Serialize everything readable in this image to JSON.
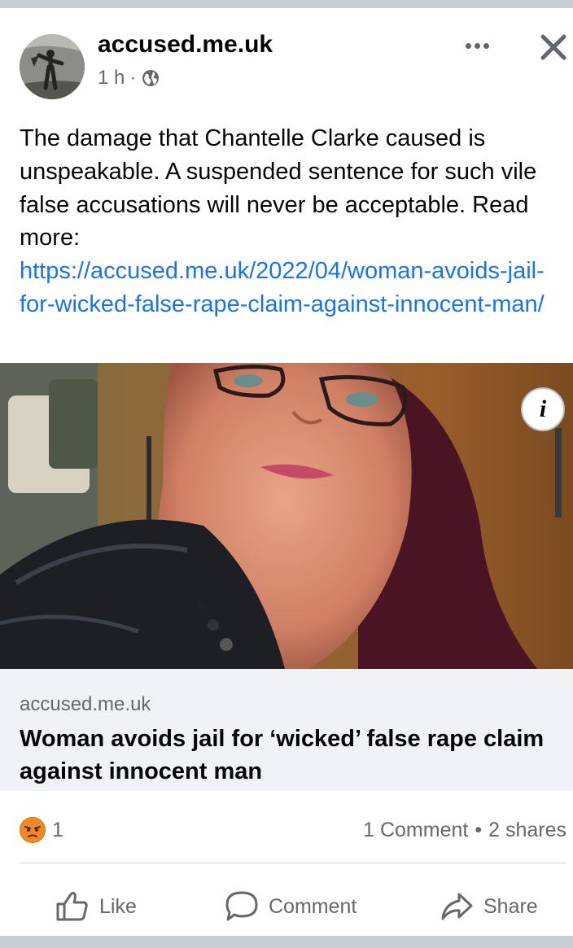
{
  "post": {
    "page_name": "accused.me.uk",
    "time": "1 h",
    "separator": "·",
    "text": "The damage that Chantelle Clarke caused is unspeakable. A suspended sentence for such vile false accusations will never be acceptable. Read more:",
    "link_url": "https://accused.me.uk/2022/04/woman-avoids-jail-for-wicked-false-rape-claim-against-innocent-man/"
  },
  "link_preview": {
    "domain": "accused.me.uk",
    "title": "Woman avoids jail for ‘wicked’ false rape claim against innocent man",
    "info_icon": "info-icon"
  },
  "engagement": {
    "reaction_icon": "angry-reaction",
    "reaction_count": "1",
    "comments": "1 Comment",
    "dot": "•",
    "shares": "2 shares"
  },
  "actions": {
    "like": "Like",
    "comment": "Comment",
    "share": "Share"
  },
  "colors": {
    "link": "#1b74e4",
    "secondary_text": "#65676b",
    "card_bg": "#f0f2f5",
    "angry_reaction": "#e9710f"
  }
}
